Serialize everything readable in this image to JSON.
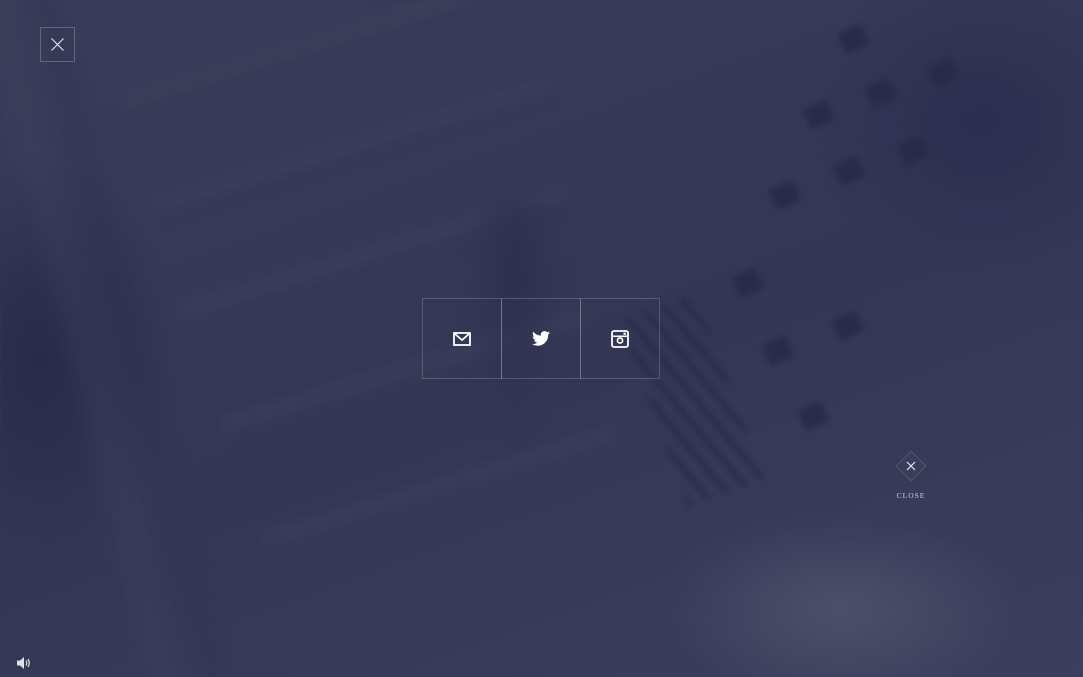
{
  "close_label": "CLOSE",
  "share": [
    {
      "icon": "mail-icon"
    },
    {
      "icon": "twitter-icon"
    },
    {
      "icon": "instagram-icon"
    }
  ],
  "icons": {
    "top_close": "close-icon",
    "diamond_close": "close-icon",
    "sound": "speaker-icon"
  },
  "colors": {
    "overlay": "#2c2f52",
    "icon": "#ffffff",
    "border": "#6b6e87"
  }
}
